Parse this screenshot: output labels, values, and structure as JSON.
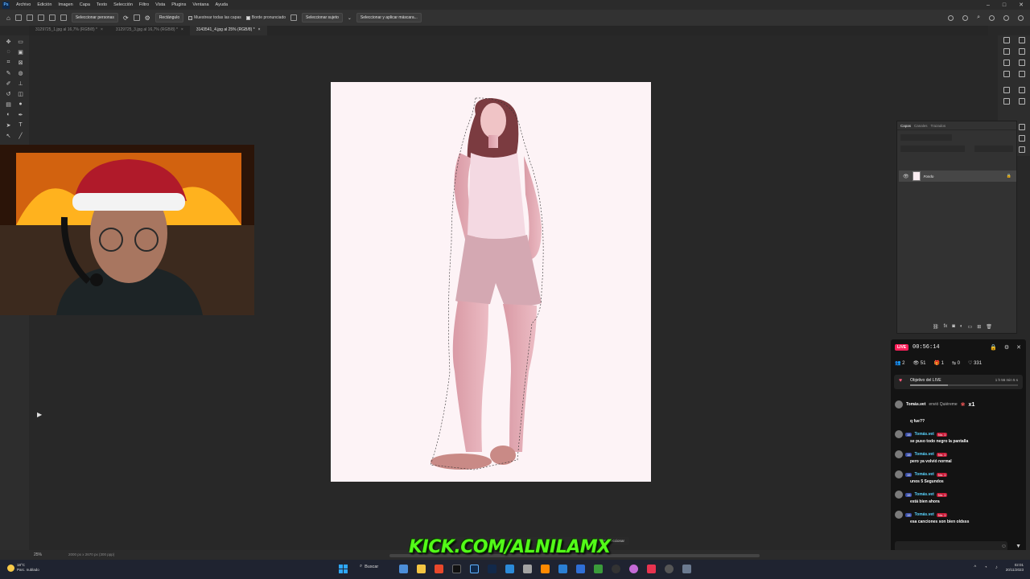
{
  "menubar": {
    "app_logo": "Ps",
    "items": [
      "Archivo",
      "Edición",
      "Imagen",
      "Capa",
      "Texto",
      "Selección",
      "Filtro",
      "Vista",
      "Plugins",
      "Ventana",
      "Ayuda"
    ]
  },
  "options": {
    "select_people": "Seleccionar personas",
    "shape": "Rectángulo",
    "sample_all_layers": "Muestrear todas las capas",
    "hard_edge": "Borde pronunciado",
    "select_subject": "Seleccionar sujeto",
    "select_mask": "Seleccionar y aplicar máscara..."
  },
  "tabs": [
    {
      "label": "3129725_1.jpg al 16,7% (RGB/8) *"
    },
    {
      "label": "3129725_3.jpg al 16,7% (RGB/8) *"
    },
    {
      "label": "3143541_4.jpg al 25% (RGB/8) *"
    }
  ],
  "layers_panel": {
    "tabs": [
      "Capas",
      "Canales",
      "Trazados"
    ],
    "layer_name": "Fondo"
  },
  "status": {
    "zoom": "25%",
    "doc_info": "2000 px x 2670 px (300 ppp)"
  },
  "floating_bar": {
    "label": "Deseleccionar"
  },
  "banner": {
    "text": "KICK.COM/ALNILAMX"
  },
  "stream": {
    "live": "LIVE",
    "timer": "00:56:14",
    "stats": [
      "2",
      "51",
      "1",
      "0",
      "331"
    ],
    "goal_title": "Objetivo del LIVE ",
    "goal_time": "1 h 56 min 5 s",
    "goal_progress": 0.35,
    "gift_user": "Tomás.vet",
    "gift_text": "envió Quiéreme",
    "gift_count": "x1",
    "first_message": "q fue??",
    "chat": [
      {
        "level": "15",
        "user": "Tomás.vet",
        "badge": "No. 1",
        "message": "se puso todo negro la pantalla"
      },
      {
        "level": "15",
        "user": "Tomás.vet",
        "badge": "No. 1",
        "message": "pero ya volvió normal"
      },
      {
        "level": "15",
        "user": "Tomás.vet",
        "badge": "No. 1",
        "message": "unos 5 Segundos"
      },
      {
        "level": "15",
        "user": "Tomás.vet",
        "badge": "No. 1",
        "message": "está bien ahora"
      },
      {
        "level": "15",
        "user": "Tomás.vet",
        "badge": "No. 1",
        "message": "esa canciones son bien oldsss"
      }
    ]
  },
  "taskbar": {
    "weather_temp": "18°C",
    "weather_desc": "Parc. nublado",
    "search": "Buscar",
    "time": "02:01",
    "date": "20/11/2023"
  },
  "colors": {
    "kick_green": "#53fc18",
    "live_red": "#ff1f5a",
    "canvas_bg": "#fdf3f6"
  }
}
